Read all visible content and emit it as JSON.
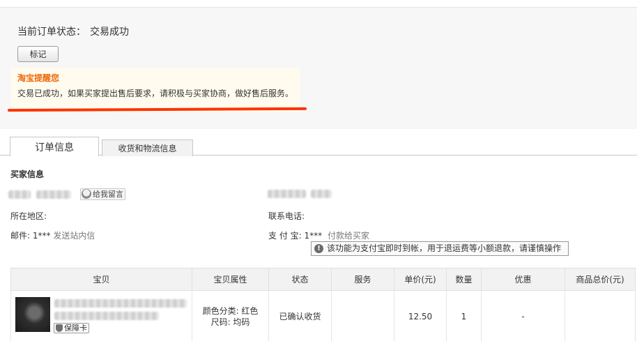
{
  "order_status": {
    "label": "当前订单状态：",
    "value": "交易成功",
    "mark_button": "标记"
  },
  "reminder": {
    "title": "淘宝提醒您",
    "text": "交易已成功，如果买家提出售后要求，请积极与买家协商，做好售后服务。"
  },
  "tabs": [
    {
      "label": "订单信息",
      "active": true
    },
    {
      "label": "收货和物流信息",
      "active": false
    }
  ],
  "buyer": {
    "section_title": "买家信息",
    "message_button": "给我留言",
    "region_label": "所在地区:",
    "email_label": "邮件:",
    "email_value": "1***",
    "email_link": "发送站内信",
    "phone_label": "联系电话:",
    "alipay_label": "支 付 宝:",
    "alipay_value": "1***",
    "alipay_link": "付款给买家",
    "alipay_warning": "该功能为支付宝即时到帐，用于退运费等小额退款，请谨慎操作"
  },
  "items_table": {
    "headers": [
      "宝贝",
      "宝贝属性",
      "状态",
      "服务",
      "单价(元)",
      "数量",
      "优惠",
      "商品总价(元)"
    ],
    "rows": [
      {
        "guarantee_badge": "保障卡",
        "attr_color": "颜色分类: 红色",
        "attr_size": "尺码: 均码",
        "status": "已确认收货",
        "service": "",
        "unit_price": "12.50",
        "quantity": "1",
        "discount": "-",
        "total": ""
      }
    ]
  },
  "icons": {
    "message": "speech-bubble-icon",
    "warning": "exclamation-icon",
    "guarantee": "shield-icon"
  },
  "colors": {
    "reminder_title": "#ee6a0a",
    "highlight_underline": "#ff3300",
    "status_bg": "#f7f7f7"
  }
}
